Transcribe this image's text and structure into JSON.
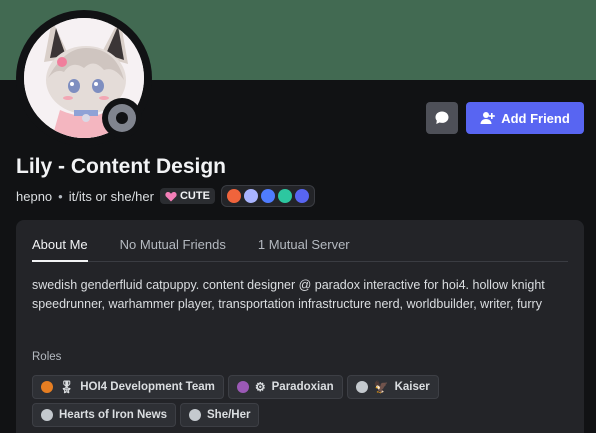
{
  "colors": {
    "banner": "#426a52",
    "background": "#111214",
    "accent": "#5865f2",
    "status_offline": "#80848e"
  },
  "actions": {
    "message_icon": "chat-bubble-icon",
    "add_friend_label": "Add Friend",
    "add_friend_icon": "add-user-icon"
  },
  "profile": {
    "display_name": "Lily - Content Design",
    "username": "hepno",
    "separator": "•",
    "pronouns": "it/its or she/her",
    "server_tag": {
      "icon": "heart-icon",
      "text": "CUTE"
    },
    "badges": [
      {
        "name": "hypesquad-badge-icon",
        "color": "#f0643c"
      },
      {
        "name": "nitro-badge-icon",
        "color": "#a9b4ff"
      },
      {
        "name": "boost-badge-icon",
        "color": "#4f7cff"
      },
      {
        "name": "hashtag-badge-icon",
        "color": "#2dc7a0"
      },
      {
        "name": "gear-badge-icon",
        "color": "#5865f2"
      }
    ]
  },
  "tabs": [
    {
      "label": "About Me",
      "active": true
    },
    {
      "label": "No Mutual Friends",
      "active": false
    },
    {
      "label": "1 Mutual Server",
      "active": false
    }
  ],
  "about": {
    "bio": "swedish genderfluid catpuppy. content designer @ paradox interactive for hoi4. hollow knight speedrunner, warhammer player, transportation infrastructure nerd, worldbuilder, writer, furry"
  },
  "roles": {
    "label": "Roles",
    "items": [
      {
        "name": "HOI4 Development Team",
        "color": "#e67e22",
        "icon": "🎖"
      },
      {
        "name": "Paradoxian",
        "color": "#9b59b6",
        "icon": "⚙"
      },
      {
        "name": "Kaiser",
        "color": "#c4c9ce",
        "icon": "🦅"
      },
      {
        "name": "Hearts of Iron News",
        "color": "#c4c9ce",
        "icon": ""
      },
      {
        "name": "She/Her",
        "color": "#c4c9ce",
        "icon": ""
      }
    ]
  }
}
